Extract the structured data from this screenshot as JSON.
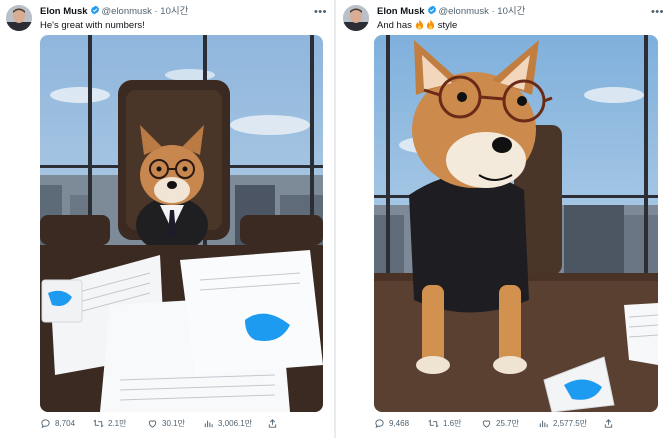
{
  "tweets": [
    {
      "author": {
        "name": "Elon Musk",
        "handle": "@elonmusk",
        "time": "10시간",
        "separator": "·"
      },
      "text": "He's great with numbers!",
      "metrics": {
        "replies": "8,704",
        "retweets": "2.1만",
        "likes": "30.1만",
        "views": "3,006.1만"
      }
    },
    {
      "author": {
        "name": "Elon Musk",
        "handle": "@elonmusk",
        "time": "10시간",
        "separator": "·"
      },
      "text_before": "And has",
      "text_after": "style",
      "metrics": {
        "replies": "9,468",
        "retweets": "1.6만",
        "likes": "25.7만",
        "views": "2,577.5만"
      }
    }
  ],
  "colors": {
    "verified": "#1d9bf0",
    "twitter_blue": "#1d9bf0",
    "muted": "#536471"
  },
  "icons": [
    "verified-badge-icon",
    "more-icon",
    "reply-icon",
    "retweet-icon",
    "like-icon",
    "views-icon",
    "share-icon",
    "fire-emoji-icon"
  ]
}
